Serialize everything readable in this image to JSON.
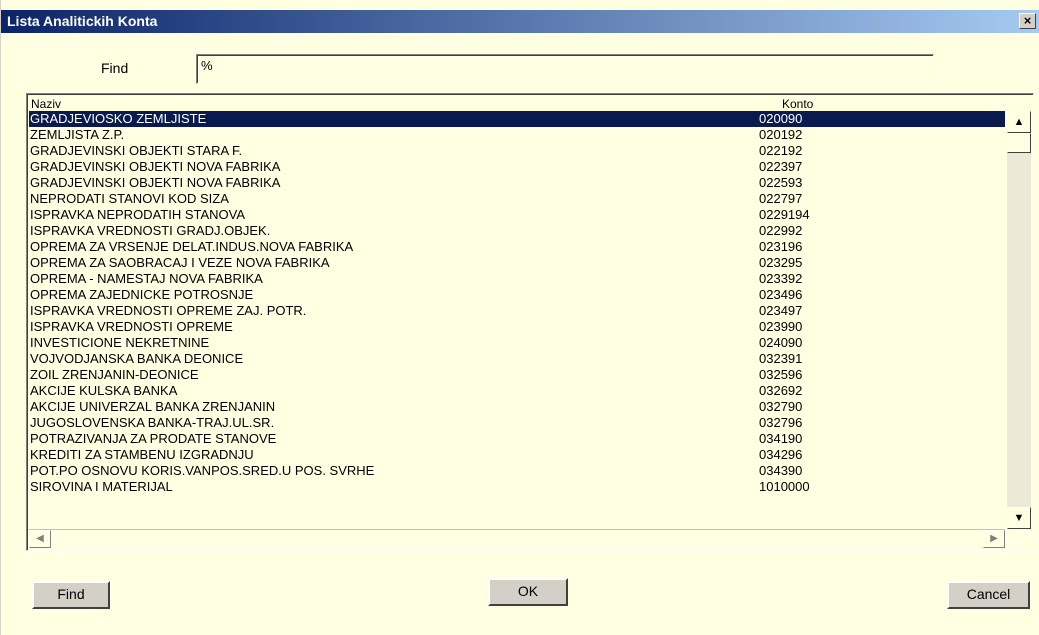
{
  "window": {
    "title": "Lista Analitickih Konta",
    "close_glyph": "×"
  },
  "search": {
    "label": "Find",
    "value": "%"
  },
  "grid": {
    "headers": {
      "name": "Naziv",
      "konto": "Konto"
    },
    "rows": [
      {
        "name": "GRADJEVIOSKO ZEMLJISTE",
        "konto": "020090"
      },
      {
        "name": "ZEMLJISTA Z.P.",
        "konto": "020192"
      },
      {
        "name": "GRADJEVINSKI OBJEKTI STARA F.",
        "konto": "022192"
      },
      {
        "name": "GRADJEVINSKI OBJEKTI NOVA FABRIKA",
        "konto": "022397"
      },
      {
        "name": "GRADJEVINSKI OBJEKTI NOVA FABRIKA",
        "konto": "022593"
      },
      {
        "name": "NEPRODATI STANOVI KOD SIZA",
        "konto": "022797"
      },
      {
        "name": "ISPRAVKA NEPRODATIH STANOVA",
        "konto": "0229194"
      },
      {
        "name": "ISPRAVKA VREDNOSTI GRADJ.OBJEK.",
        "konto": "022992"
      },
      {
        "name": "OPREMA ZA VRSENJE DELAT.INDUS.NOVA FABRIKA",
        "konto": "023196"
      },
      {
        "name": "OPREMA ZA SAOBRACAJ I VEZE NOVA FABRIKA",
        "konto": "023295"
      },
      {
        "name": "OPREMA - NAMESTAJ NOVA FABRIKA",
        "konto": "023392"
      },
      {
        "name": "OPREMA ZAJEDNICKE POTROSNJE",
        "konto": "023496"
      },
      {
        "name": "ISPRAVKA VREDNOSTI OPREME ZAJ. POTR.",
        "konto": "023497"
      },
      {
        "name": "ISPRAVKA VREDNOSTI OPREME",
        "konto": "023990"
      },
      {
        "name": "INVESTICIONE NEKRETNINE",
        "konto": "024090"
      },
      {
        "name": "VOJVODJANSKA BANKA DEONICE",
        "konto": "032391"
      },
      {
        "name": "ZOIL ZRENJANIN-DEONICE",
        "konto": "032596"
      },
      {
        "name": "AKCIJE KULSKA BANKA",
        "konto": "032692"
      },
      {
        "name": "AKCIJE UNIVERZAL BANKA ZRENJANIN",
        "konto": "032790"
      },
      {
        "name": "JUGOSLOVENSKA BANKA-TRAJ.UL.SR.",
        "konto": "032796"
      },
      {
        "name": "POTRAZIVANJA ZA PRODATE STANOVE",
        "konto": "034190"
      },
      {
        "name": "KREDITI ZA STAMBENU IZGRADNJU",
        "konto": "034296"
      },
      {
        "name": "POT.PO OSNOVU KORIS.VANPOS.SRED.U POS. SVRHE",
        "konto": "034390"
      },
      {
        "name": "SIROVINA I MATERIJAL",
        "konto": "1010000"
      }
    ],
    "selected_index": 0
  },
  "buttons": {
    "find": "Find",
    "ok": "OK",
    "cancel": "Cancel"
  },
  "colors": {
    "background": "#ffffe1",
    "selection": "#0a1a4e",
    "titlebar": "#0a246a"
  }
}
